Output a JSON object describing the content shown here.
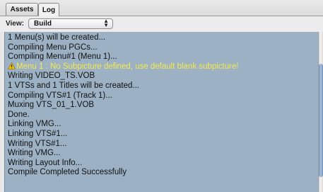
{
  "tabs": [
    {
      "label": "Assets",
      "selected": false
    },
    {
      "label": "Log",
      "selected": true
    }
  ],
  "view": {
    "label": "View:",
    "selected": "Build"
  },
  "log": {
    "lines": [
      {
        "text": "1 Menu(s) will be created...",
        "type": "info"
      },
      {
        "text": "Compiling Menu PGCs...",
        "type": "info"
      },
      {
        "text": "Compiling Menu#1 (Menu 1)...",
        "type": "info"
      },
      {
        "text": "Menu 1 : No Subpicture defined, use default blank subpicture!",
        "type": "warning"
      },
      {
        "text": "Writing VIDEO_TS.VOB",
        "type": "info"
      },
      {
        "text": "1 VTSs and 1 Titles will be created...",
        "type": "info"
      },
      {
        "text": "Compiling VTS#1 (Track 1)...",
        "type": "info"
      },
      {
        "text": "Muxing VTS_01_1.VOB",
        "type": "info"
      },
      {
        "text": "Done.",
        "type": "info"
      },
      {
        "text": "Linking VMG...",
        "type": "info"
      },
      {
        "text": "Linking VTS#1...",
        "type": "info"
      },
      {
        "text": "Writing VTS#1...",
        "type": "info"
      },
      {
        "text": "Writing VMG...",
        "type": "info"
      },
      {
        "text": "Writing Layout Info...",
        "type": "info"
      },
      {
        "text": "Compile Completed Successfully",
        "type": "info"
      }
    ]
  },
  "colors": {
    "log_background": "#9cb1c3",
    "warning_text": "#f5e84c",
    "warning_icon": "#f2c200"
  },
  "icons": {
    "warning": "warning-triangle-icon",
    "select_arrows": "up-down-arrows-icon"
  }
}
